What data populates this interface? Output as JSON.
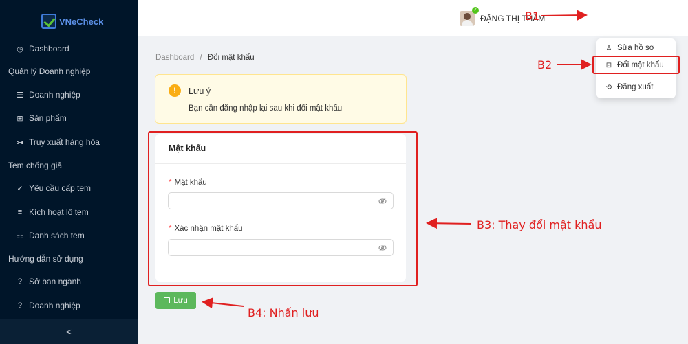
{
  "sidebar": {
    "logo_text_colored": "VNe",
    "logo_text_rest": "Check",
    "items": [
      {
        "label": "Dashboard",
        "icon": "dashboard-icon"
      },
      {
        "label": "Doanh nghiệp",
        "icon": "list-icon"
      },
      {
        "label": "Sản phẩm",
        "icon": "grid-icon"
      },
      {
        "label": "Truy xuất hàng hóa",
        "icon": "nodes-icon"
      },
      {
        "label": "Yêu cầu cấp tem",
        "icon": "check-icon"
      },
      {
        "label": "Kích hoạt lô tem",
        "icon": "bars-icon"
      },
      {
        "label": "Danh sách tem",
        "icon": "table-icon"
      },
      {
        "label": "Sở ban ngành",
        "icon": "question-icon"
      },
      {
        "label": "Doanh nghiệp",
        "icon": "question-icon"
      }
    ],
    "groups": [
      "Quản lý Doanh nghiệp",
      "Tem chống giả",
      "Hướng dẫn sử dụng"
    ],
    "collapse_label": "<"
  },
  "header": {
    "username": "ĐẶNG THỊ THẮM"
  },
  "dropdown": {
    "items": [
      "Sửa hồ sơ",
      "Đổi mật khẩu",
      "Đăng xuất"
    ]
  },
  "breadcrumb": {
    "home": "Dashboard",
    "separator": "/",
    "current": "Đổi mật khẩu"
  },
  "alert": {
    "icon": "!",
    "title": "Lưu ý",
    "description": "Bạn cần đăng nhập lại sau khi đổi mật khẩu"
  },
  "form": {
    "card_title": "Mật khẩu",
    "password_label": "Mật khẩu",
    "confirm_label": "Xác nhận mật khẩu",
    "password_value": "",
    "confirm_value": "",
    "required_mark": "*"
  },
  "save_label": "Lưu",
  "annotations": {
    "b1": "B1",
    "b2": "B2",
    "b3": "B3: Thay đổi mật khẩu",
    "b4": "B4: Nhấn lưu"
  },
  "colors": {
    "sidebar_bg": "#001529",
    "save_button": "#5cb85c",
    "annotation_red": "#e02020",
    "alert_bg": "#fffbe6"
  }
}
